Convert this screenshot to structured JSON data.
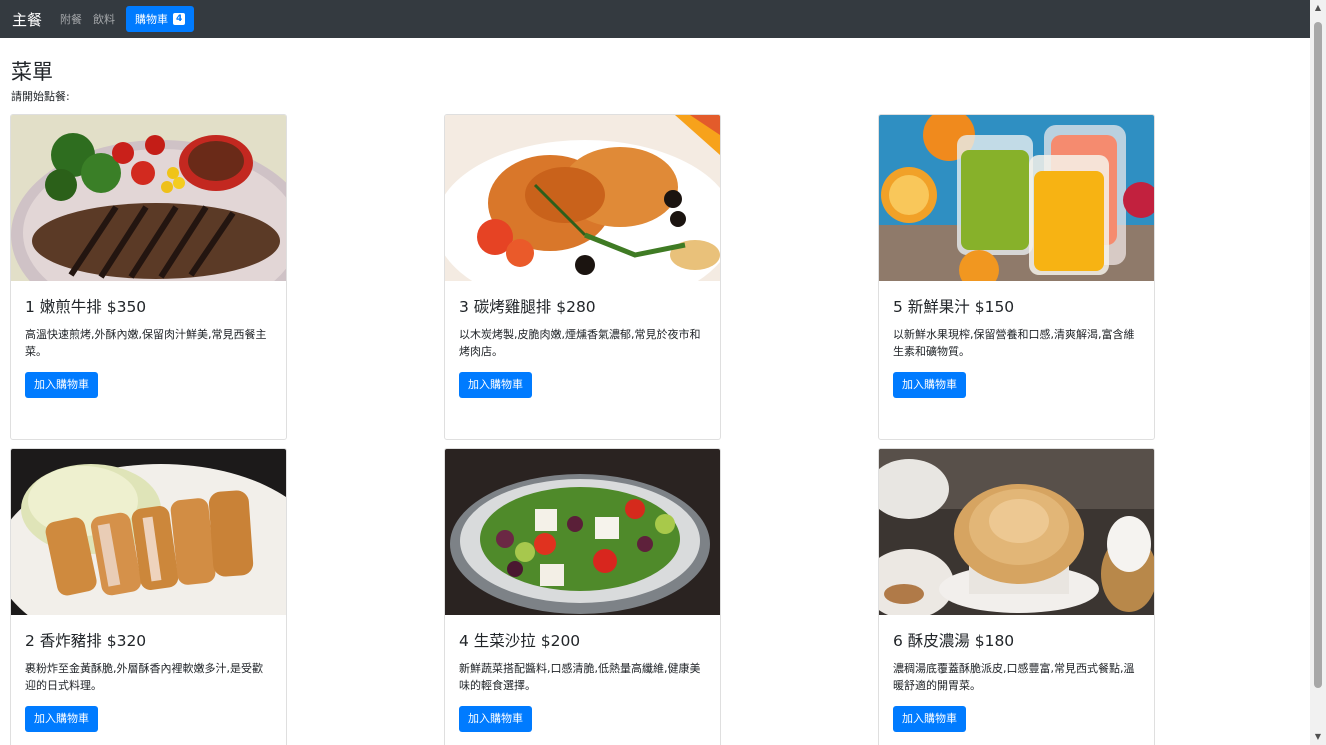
{
  "navbar": {
    "brand": "主餐",
    "links": [
      "附餐",
      "飲料"
    ],
    "cart_label": "購物車",
    "cart_count": "4"
  },
  "page": {
    "title": "菜單",
    "subtitle": "請開始點餐:"
  },
  "button_label": "加入購物車",
  "menu": [
    {
      "title": "1 嫩煎牛排 $350",
      "desc": "高溫快速煎烤,外酥內嫩,保留肉汁鮮美,常見西餐主菜。"
    },
    {
      "title": "3 碳烤雞腿排 $280",
      "desc": "以木炭烤製,皮脆肉嫩,煙燻香氣濃郁,常見於夜市和烤肉店。"
    },
    {
      "title": "5 新鮮果汁 $150",
      "desc": "以新鮮水果現榨,保留營養和口感,清爽解渴,富含維生素和礦物質。"
    },
    {
      "title": "2 香炸豬排 $320",
      "desc": "裹粉炸至金黃酥脆,外層酥香內裡軟嫩多汁,是受歡迎的日式料理。"
    },
    {
      "title": "4 生菜沙拉 $200",
      "desc": "新鮮蔬菜搭配醬料,口感清脆,低熱量高纖維,健康美味的輕食選擇。"
    },
    {
      "title": "6 酥皮濃湯 $180",
      "desc": "濃稠湯底覆蓋酥脆派皮,口感豐富,常見西式餐點,溫暖舒適的開胃菜。"
    }
  ]
}
